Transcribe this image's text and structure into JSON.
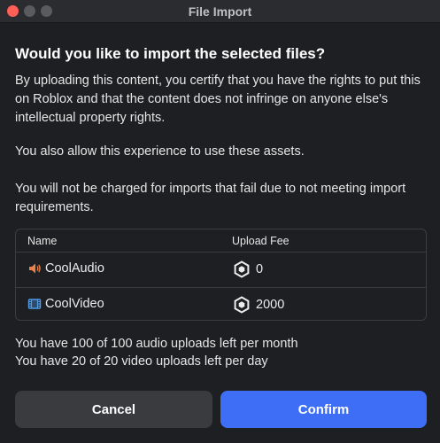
{
  "window": {
    "title": "File Import"
  },
  "dialog": {
    "heading": "Would you like to import the selected files?",
    "paragraph_rights": "By uploading this content, you certify that you have the rights to put this on Roblox and that the content does not infringe on anyone else's intellectual property rights.",
    "paragraph_experience": "You also allow this experience to use these assets.",
    "paragraph_charges": "You will not be charged for imports that fail due to not meeting import requirements."
  },
  "table": {
    "headers": {
      "name": "Name",
      "fee": "Upload Fee"
    },
    "rows": [
      {
        "name": "CoolAudio",
        "fee": "0",
        "icon": "audio-icon",
        "icon_color": "#e8834a"
      },
      {
        "name": "CoolVideo",
        "fee": "2000",
        "icon": "video-icon",
        "icon_color": "#4f9be8"
      }
    ]
  },
  "quota": {
    "audio": "You have 100 of 100 audio uploads left per month",
    "video": "You have 20 of 20 video uploads left per day"
  },
  "buttons": {
    "cancel": "Cancel",
    "confirm": "Confirm"
  },
  "colors": {
    "confirm": "#3e6ef6",
    "cancel": "#393b3f",
    "close": "#ff5f57"
  }
}
